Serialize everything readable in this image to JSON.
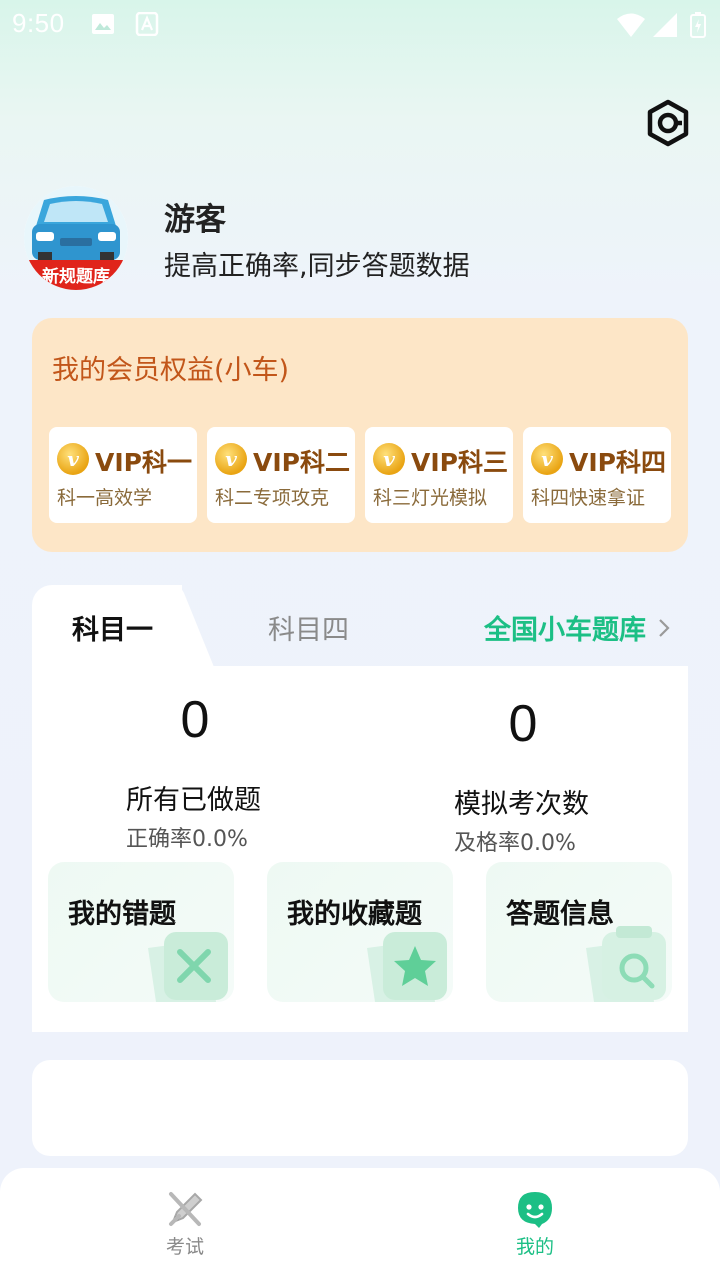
{
  "status_bar": {
    "time": "9:50"
  },
  "user": {
    "name": "游客",
    "subtitle": "提高正确率,同步答题数据",
    "avatar_caption": "新规题库"
  },
  "vip": {
    "title": "我的会员权益(小车)",
    "badge_letter": "v",
    "items": [
      {
        "name": "VIP科一",
        "desc": "科一高效学"
      },
      {
        "name": "VIP科二",
        "desc": "科二专项攻克"
      },
      {
        "name": "VIP科三",
        "desc": "科三灯光模拟"
      },
      {
        "name": "VIP科四",
        "desc": "科四快速拿证"
      }
    ]
  },
  "subjects": {
    "tabs": [
      {
        "label": "科目一"
      },
      {
        "label": "科目四"
      }
    ],
    "active_tab": "科目一",
    "bank_link": "全国小车题库",
    "stats": [
      {
        "value": "0",
        "label": "所有已做题",
        "rate": "正确率0.0%"
      },
      {
        "value": "0",
        "label": "模拟考次数",
        "rate": "及格率0.0%"
      }
    ],
    "features": [
      {
        "label": "我的错题",
        "icon": "x-mark-icon"
      },
      {
        "label": "我的收藏题",
        "icon": "star-icon"
      },
      {
        "label": "答题信息",
        "icon": "search-icon"
      }
    ]
  },
  "bottom_nav": {
    "items": [
      {
        "label": "考试",
        "icon": "pencil-icon",
        "active": false
      },
      {
        "label": "我的",
        "icon": "profile-face-icon",
        "active": true
      }
    ]
  },
  "colors": {
    "accent": "#1cbf85",
    "vip_bg": "#fde6c7",
    "vip_title": "#c2561a",
    "inactive": "#8a8a8a"
  }
}
